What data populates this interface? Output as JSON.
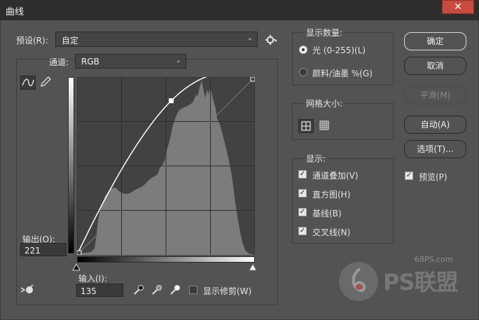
{
  "window": {
    "title": "曲线",
    "close_glyph": "✕"
  },
  "preset": {
    "label": "预设(R):",
    "value": "自定"
  },
  "channel": {
    "label": "通道:",
    "value": "RGB"
  },
  "curve_tools": [
    "curve-point-tool-icon",
    "pencil-icon"
  ],
  "output": {
    "label": "输出(O):",
    "value": "221"
  },
  "input": {
    "label": "输入(I):",
    "value": "135"
  },
  "curve": {
    "points": [
      [
        0,
        0
      ],
      [
        135,
        221
      ],
      [
        255,
        255
      ]
    ],
    "curve_color": "#ffffff",
    "graph_background": "#424242",
    "histogram_color": "#7c7c7c"
  },
  "show_clipping": {
    "label": "显示修剪(W)",
    "checked": false
  },
  "display_amount": {
    "title": "显示数量:",
    "options": [
      {
        "label": "光 (0-255)(L)",
        "selected": true
      },
      {
        "label": "颜料/油墨 %(G)",
        "selected": false
      }
    ]
  },
  "grid_size": {
    "title": "网格大小:",
    "options": [
      "grid-4x4-icon",
      "grid-10x10-icon"
    ],
    "selected": 0
  },
  "show": {
    "title": "显示:",
    "items": [
      {
        "label": "通道叠加(V)",
        "checked": true
      },
      {
        "label": "直方图(H)",
        "checked": true
      },
      {
        "label": "基线(B)",
        "checked": true
      },
      {
        "label": "交叉线(N)",
        "checked": true
      }
    ]
  },
  "buttons": {
    "ok": "确定",
    "cancel": "取消",
    "smooth": "平滑(M)",
    "auto": "自动(A)",
    "options": "选项(T)..."
  },
  "preview": {
    "label": "预览(P)",
    "checked": true
  },
  "watermark": {
    "site": "68PS.com",
    "brand": "PS联盟"
  }
}
